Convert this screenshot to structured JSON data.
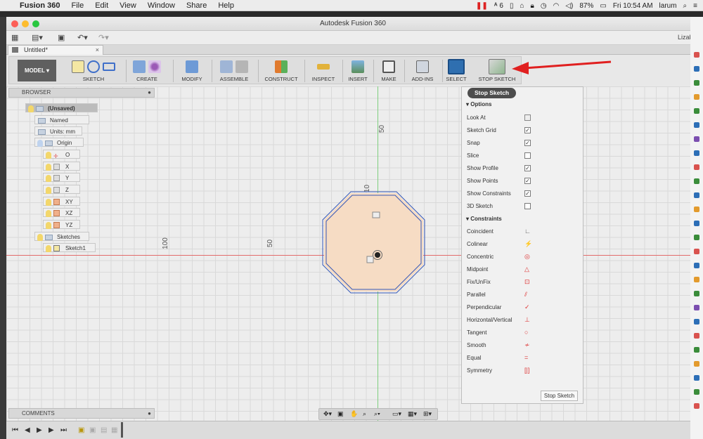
{
  "menubar": {
    "apple": "",
    "app": "Fusion 360",
    "items": [
      "File",
      "Edit",
      "View",
      "Window",
      "Share",
      "Help"
    ],
    "badge": "6",
    "battery": "87%",
    "clock": "Fri 10:54 AM",
    "user": "larum"
  },
  "window": {
    "title": "Autodesk Fusion 360",
    "user_short": "Lizabet",
    "doc_tab": "Untitled*"
  },
  "ribbon": {
    "mode": "MODEL",
    "groups": [
      "SKETCH",
      "CREATE",
      "MODIFY",
      "ASSEMBLE",
      "CONSTRUCT",
      "INSPECT",
      "INSERT",
      "MAKE",
      "ADD-INS",
      "SELECT",
      "STOP SKETCH"
    ]
  },
  "browser": {
    "title": "BROWSER",
    "root": "(Unsaved)",
    "named_views": "Named Views",
    "units": "Units: mm",
    "origin": "Origin",
    "origin_items": [
      "O",
      "X",
      "Y",
      "Z",
      "XY",
      "XZ",
      "YZ"
    ],
    "sketches": "Sketches",
    "sketch1": "Sketch1"
  },
  "canvas": {
    "dim_vertical": "50",
    "dim_left_far": "100",
    "dim_left_near": "50",
    "dim_small": "10"
  },
  "palette": {
    "tooltip": "Stop Sketch",
    "options_header": "Options",
    "options": [
      {
        "label": "Look At",
        "checked": null
      },
      {
        "label": "Sketch Grid",
        "checked": true
      },
      {
        "label": "Snap",
        "checked": true
      },
      {
        "label": "Slice",
        "checked": false
      },
      {
        "label": "Show Profile",
        "checked": true
      },
      {
        "label": "Show Points",
        "checked": true
      },
      {
        "label": "Show Constraints",
        "checked": true
      },
      {
        "label": "3D Sketch",
        "checked": false
      }
    ],
    "constraints_header": "Constraints",
    "constraints": [
      "Coincident",
      "Colinear",
      "Concentric",
      "Midpoint",
      "Fix/UnFix",
      "Parallel",
      "Perpendicular",
      "Horizontal/Vertical",
      "Tangent",
      "Smooth",
      "Equal",
      "Symmetry"
    ],
    "stop_button": "Stop Sketch"
  },
  "comments": {
    "title": "COMMENTS"
  },
  "colors": {
    "accent": "#e02020",
    "select_blue": "#2f6fb0",
    "profile_fill": "#f6dcc4",
    "sketch_line": "#3558b8"
  }
}
